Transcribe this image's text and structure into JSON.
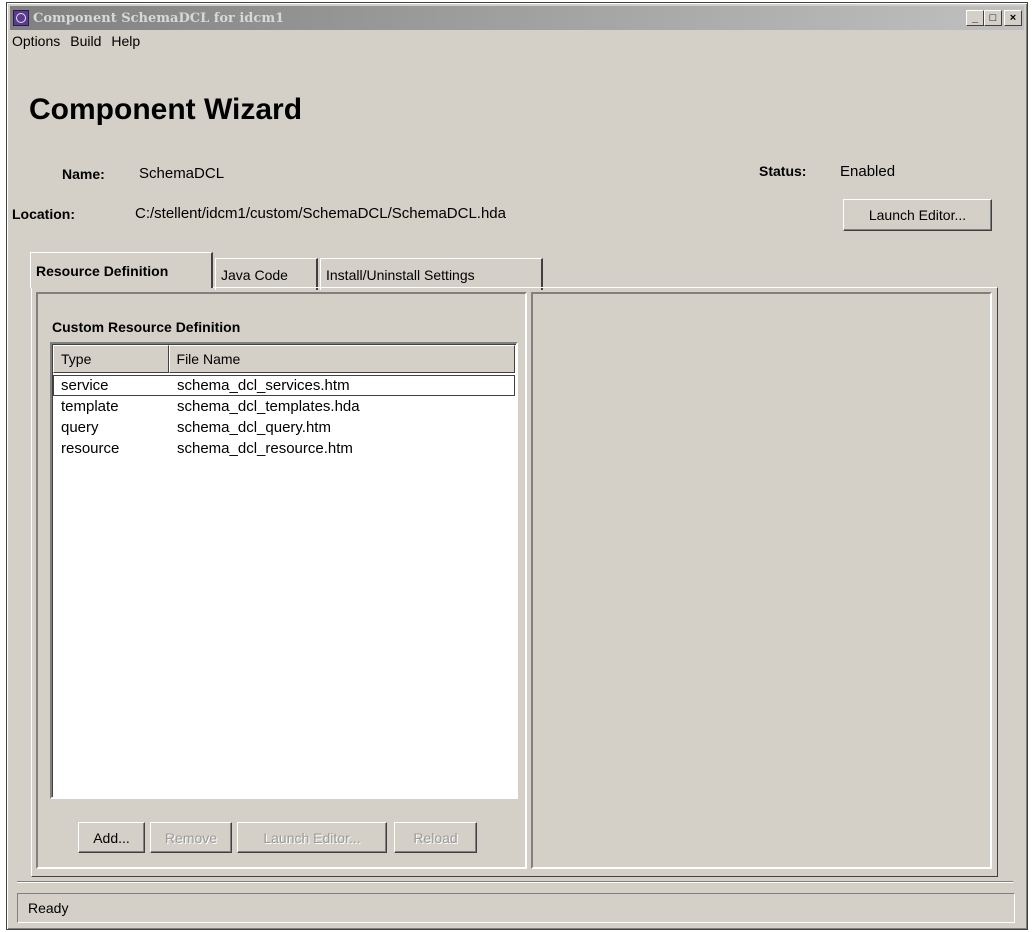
{
  "window": {
    "title": "Component SchemaDCL for idcm1",
    "minimize_glyph": "_",
    "maximize_glyph": "□",
    "close_glyph": "×"
  },
  "menu": [
    "Options",
    "Build",
    "Help"
  ],
  "heading": "Component Wizard",
  "info": {
    "name_label": "Name:",
    "name_value": "SchemaDCL",
    "status_label": "Status:",
    "status_value": "Enabled",
    "location_label": "Location:",
    "location_value": "C:/stellent/idcm1/custom/SchemaDCL/SchemaDCL.hda",
    "launch_editor_label": "Launch Editor..."
  },
  "tabs": [
    {
      "label": "Resource Definition",
      "active": true
    },
    {
      "label": "Java Code",
      "active": false
    },
    {
      "label": "Install/Uninstall Settings",
      "active": false
    }
  ],
  "resource_panel": {
    "section_title": "Custom Resource Definition",
    "columns": [
      "Type",
      "File Name"
    ],
    "rows": [
      {
        "type": "service",
        "file": "schema_dcl_services.htm",
        "selected": true
      },
      {
        "type": "template",
        "file": "schema_dcl_templates.hda",
        "selected": false
      },
      {
        "type": "query",
        "file": "schema_dcl_query.htm",
        "selected": false
      },
      {
        "type": "resource",
        "file": "schema_dcl_resource.htm",
        "selected": false
      }
    ],
    "buttons": {
      "add": "Add...",
      "remove": "Remove",
      "launch_editor": "Launch Editor...",
      "reload": "Reload"
    }
  },
  "status_bar": "Ready"
}
